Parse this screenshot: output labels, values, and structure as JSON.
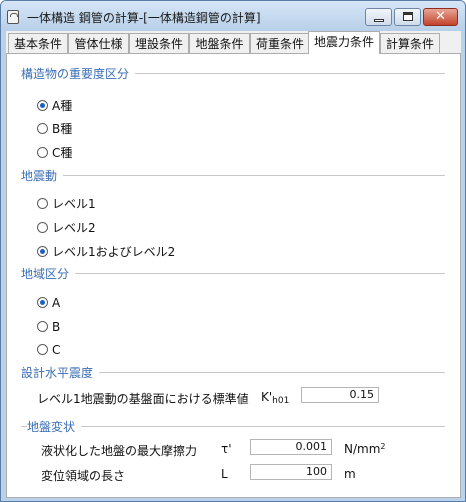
{
  "window": {
    "title": "一体構造 鋼管の計算-[一体構造鋼管の計算]",
    "close_glyph": "✕"
  },
  "tabs": [
    {
      "label": "基本条件"
    },
    {
      "label": "管体仕様"
    },
    {
      "label": "埋設条件"
    },
    {
      "label": "地盤条件"
    },
    {
      "label": "荷重条件"
    },
    {
      "label": "地震力条件",
      "active": true
    },
    {
      "label": "計算条件"
    }
  ],
  "importance": {
    "label": "構造物の重要度区分",
    "options": [
      "A種",
      "B種",
      "C種"
    ],
    "selected": "A種"
  },
  "ground_motion": {
    "label": "地震動",
    "options": [
      "レベル1",
      "レベル2",
      "レベル1およびレベル2"
    ],
    "selected": "レベル1およびレベル2"
  },
  "region": {
    "label": "地域区分",
    "options": [
      "A",
      "B",
      "C"
    ],
    "selected": "A"
  },
  "seismic_coefficient": {
    "label": "設計水平震度",
    "row_label": "レベル1地震動の基盤面における標準値",
    "symbol": "K'",
    "symbol_sub": "h01",
    "value": "0.15"
  },
  "ground_displacement": {
    "label": "地盤変状",
    "friction": {
      "label": "液状化した地盤の最大摩擦力",
      "symbol": "τ'",
      "value": "0.001",
      "unit": "N/mm",
      "unit_sup": "2"
    },
    "length": {
      "label": "変位領域の長さ",
      "symbol": "L",
      "value": "100",
      "unit": "m"
    }
  },
  "icons": {
    "app": "document-icon",
    "minimize": "minimize-icon",
    "maximize": "maximize-icon",
    "close": "close-icon"
  }
}
